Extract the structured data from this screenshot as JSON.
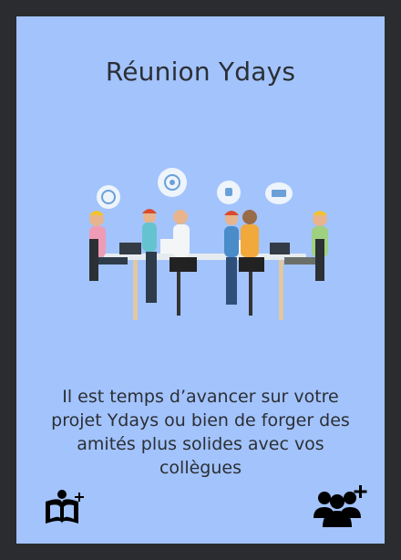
{
  "card": {
    "title": "Réunion Ydays",
    "description": "Il est temps d’avancer sur votre projet Ydays ou bien de forger des amités plus solides avec vos collègues"
  },
  "icons": {
    "illustration": "team-meeting-illustration",
    "left_action": "book-plus-icon",
    "right_action": "group-plus-icon"
  },
  "colors": {
    "background": "#2a2c2f",
    "card": "#a3c3fc",
    "text": "#2b2f35"
  }
}
